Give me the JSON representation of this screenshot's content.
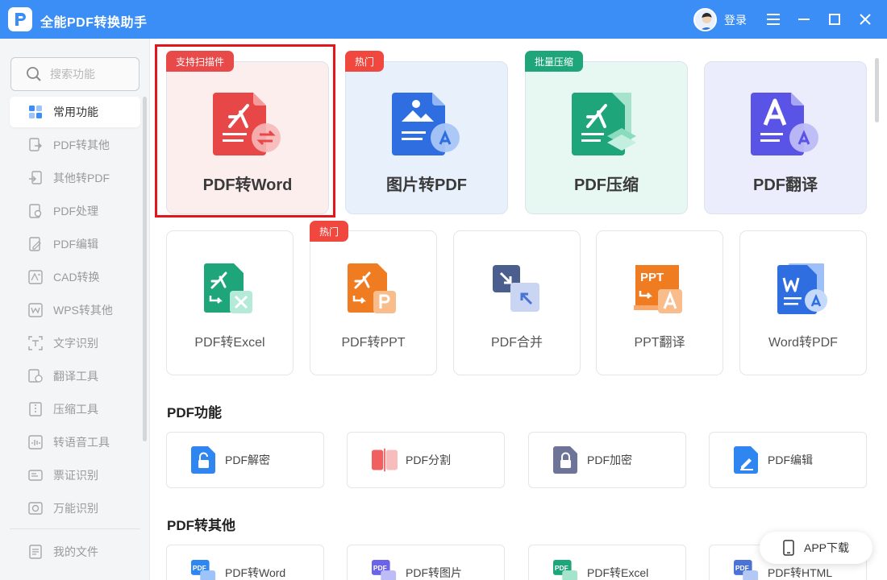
{
  "app": {
    "title": "全能PDF转换助手",
    "login": "登录"
  },
  "search": {
    "placeholder": "搜索功能"
  },
  "sidebar": {
    "items": [
      {
        "label": "常用功能",
        "icon": "grid-icon",
        "active": true
      },
      {
        "label": "PDF转其他",
        "icon": "pdf-to-other-icon"
      },
      {
        "label": "其他转PDF",
        "icon": "other-to-pdf-icon"
      },
      {
        "label": "PDF处理",
        "icon": "pdf-process-icon"
      },
      {
        "label": "PDF编辑",
        "icon": "pdf-edit-icon"
      },
      {
        "label": "CAD转换",
        "icon": "cad-icon"
      },
      {
        "label": "WPS转其他",
        "icon": "wps-icon"
      },
      {
        "label": "文字识别",
        "icon": "ocr-icon"
      },
      {
        "label": "翻译工具",
        "icon": "translate-icon"
      },
      {
        "label": "压缩工具",
        "icon": "compress-icon"
      },
      {
        "label": "转语音工具",
        "icon": "voice-icon"
      },
      {
        "label": "票证识别",
        "icon": "ticket-icon"
      },
      {
        "label": "万能识别",
        "icon": "universal-icon"
      }
    ],
    "my_files": "我的文件"
  },
  "featured": [
    {
      "label": "PDF转Word",
      "badge": "支持扫描件",
      "badge_color": "#e84a4a",
      "bg": "#fdeeee",
      "accent": "#e84747"
    },
    {
      "label": "图片转PDF",
      "badge": "热门",
      "badge_color": "#f0483e",
      "bg": "#e8f0fc",
      "accent": "#2f6ee0"
    },
    {
      "label": "PDF压缩",
      "badge": "批量压缩",
      "badge_color": "#1fa57a",
      "bg": "#e7f7f1",
      "accent": "#1fa57a"
    },
    {
      "label": "PDF翻译",
      "badge": "",
      "badge_color": "",
      "bg": "#ecedfc",
      "accent": "#5a54e6"
    }
  ],
  "tools": [
    {
      "label": "PDF转Excel",
      "badge": ""
    },
    {
      "label": "PDF转PPT",
      "badge": "热门"
    },
    {
      "label": "PDF合并",
      "badge": ""
    },
    {
      "label": "PPT翻译",
      "badge": ""
    },
    {
      "label": "Word转PDF",
      "badge": ""
    }
  ],
  "sections": {
    "pdf_features": {
      "title": "PDF功能",
      "items": [
        "PDF解密",
        "PDF分割",
        "PDF加密",
        "PDF编辑"
      ]
    },
    "pdf_to_other": {
      "title": "PDF转其他",
      "items": [
        "PDF转Word",
        "PDF转图片",
        "PDF转Excel",
        "PDF转HTML"
      ]
    }
  },
  "app_download": "APP下载"
}
